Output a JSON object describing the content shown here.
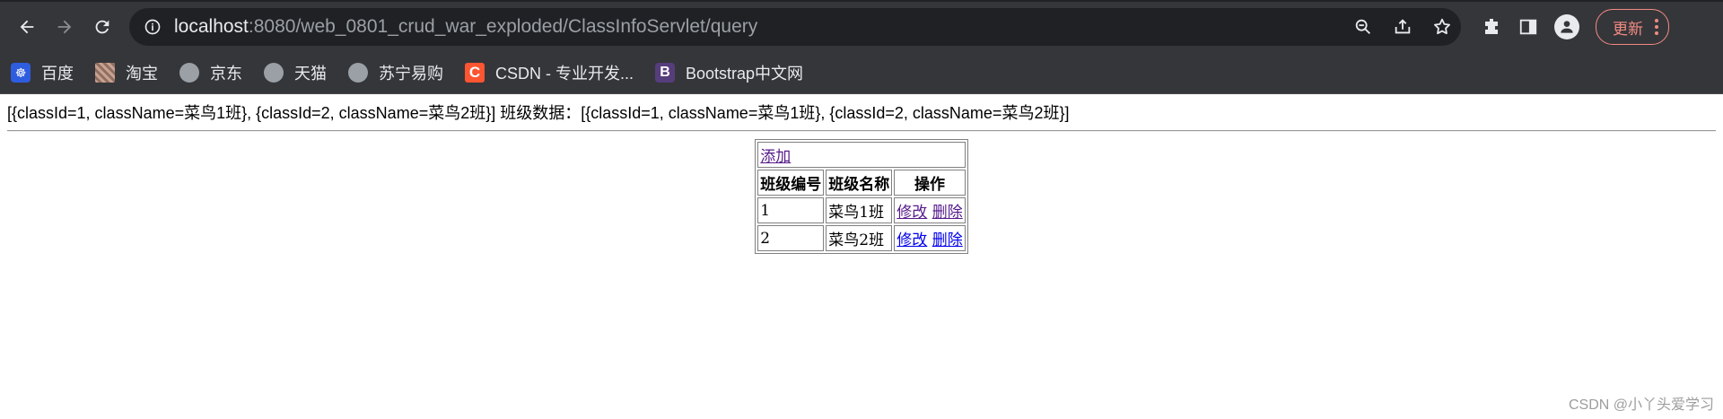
{
  "browser": {
    "url_host": "localhost",
    "url_rest": ":8080/web_0801_crud_war_exploded/ClassInfoServlet/query",
    "update_label": "更新"
  },
  "bookmarks": [
    {
      "label": "百度",
      "icon": "baidu-icon"
    },
    {
      "label": "淘宝",
      "icon": "taobao-icon"
    },
    {
      "label": "京东",
      "icon": "globe-icon"
    },
    {
      "label": "天猫",
      "icon": "globe-icon"
    },
    {
      "label": "苏宁易购",
      "icon": "globe-icon"
    },
    {
      "label": "CSDN - 专业开发...",
      "icon": "csdn-icon"
    },
    {
      "label": "Bootstrap中文网",
      "icon": "bootstrap-icon"
    }
  ],
  "page": {
    "data_line": "[{classId=1, className=菜鸟1班}, {classId=2, className=菜鸟2班}] 班级数据：[{classId=1, className=菜鸟1班}, {classId=2, className=菜鸟2班}]",
    "add_link": "添加",
    "headers": [
      "班级编号",
      "班级名称",
      "操作"
    ],
    "rows": [
      {
        "id": "1",
        "name": "菜鸟1班",
        "edit": "修改",
        "delete": "删除"
      },
      {
        "id": "2",
        "name": "菜鸟2班",
        "edit": "修改",
        "delete": "删除"
      }
    ]
  },
  "watermark": "CSDN @小丫头爱学习"
}
